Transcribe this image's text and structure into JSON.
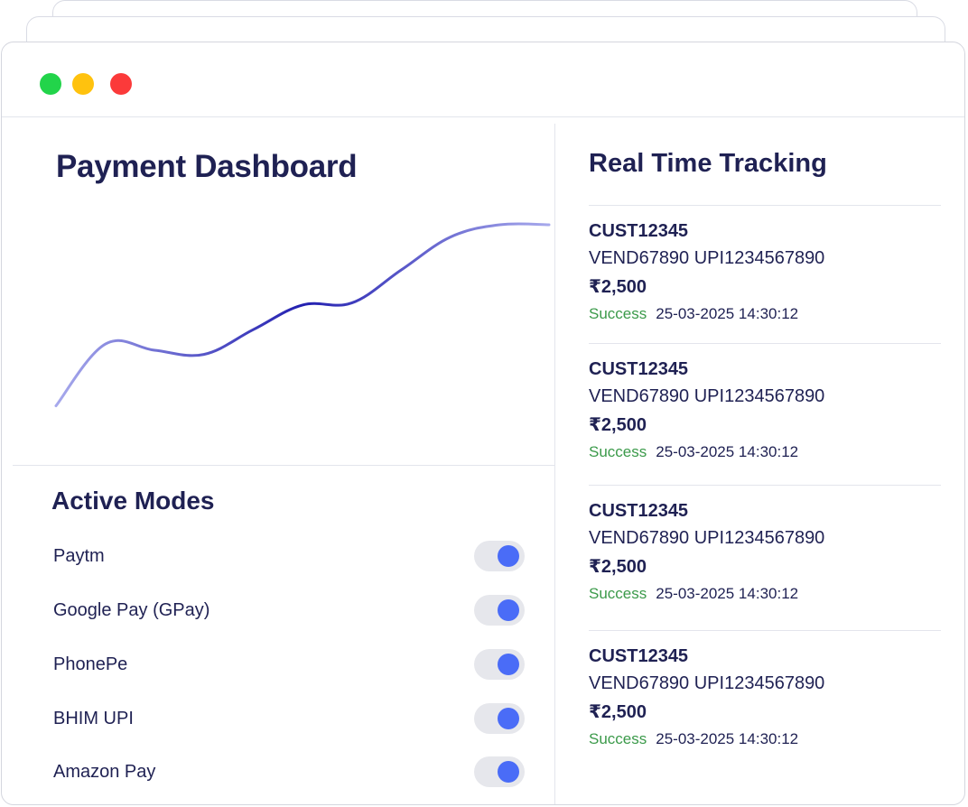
{
  "window": {
    "dots": [
      {
        "name": "green",
        "color": "#22d44a"
      },
      {
        "name": "yellow",
        "color": "#ffc20e"
      },
      {
        "name": "red",
        "color": "#fb3a3a"
      }
    ]
  },
  "dashboard": {
    "title": "Payment Dashboard"
  },
  "chart_data": {
    "type": "line",
    "title": "",
    "xlabel": "",
    "ylabel": "",
    "grid": false,
    "legend": "none",
    "x": [
      0,
      1,
      2,
      3,
      4,
      5,
      6,
      7,
      8,
      9,
      10
    ],
    "series": [
      {
        "values": [
          5,
          35,
          32,
          30,
          42,
          54,
          55,
          71,
          87,
          93,
          93
        ]
      }
    ],
    "ylim": [
      0,
      100
    ],
    "colors": {
      "edge": "#a7a9ec",
      "mid": "#2320b0"
    }
  },
  "active_modes": {
    "title": "Active Modes",
    "accent_color": "#4a6cf7",
    "items": [
      {
        "label": "Paytm",
        "enabled": true
      },
      {
        "label": "Google Pay (GPay)",
        "enabled": true
      },
      {
        "label": "PhonePe",
        "enabled": true
      },
      {
        "label": "BHIM UPI",
        "enabled": true
      },
      {
        "label": "Amazon Pay",
        "enabled": true
      }
    ]
  },
  "tracking": {
    "title": "Real Time Tracking",
    "status_color": "#3b9a4a",
    "transactions": [
      {
        "customer": "CUST12345",
        "ids": "VEND67890 UPI1234567890",
        "amount": "₹2,500",
        "status": "Success",
        "timestamp": "25-03-2025 14:30:12"
      },
      {
        "customer": "CUST12345",
        "ids": "VEND67890 UPI1234567890",
        "amount": "₹2,500",
        "status": "Success",
        "timestamp": "25-03-2025 14:30:12"
      },
      {
        "customer": "CUST12345",
        "ids": "VEND67890 UPI1234567890",
        "amount": "₹2,500",
        "status": "Success",
        "timestamp": "25-03-2025 14:30:12"
      },
      {
        "customer": "CUST12345",
        "ids": "VEND67890 UPI1234567890",
        "amount": "₹2,500",
        "status": "Success",
        "timestamp": "25-03-2025 14:30:12"
      }
    ]
  }
}
